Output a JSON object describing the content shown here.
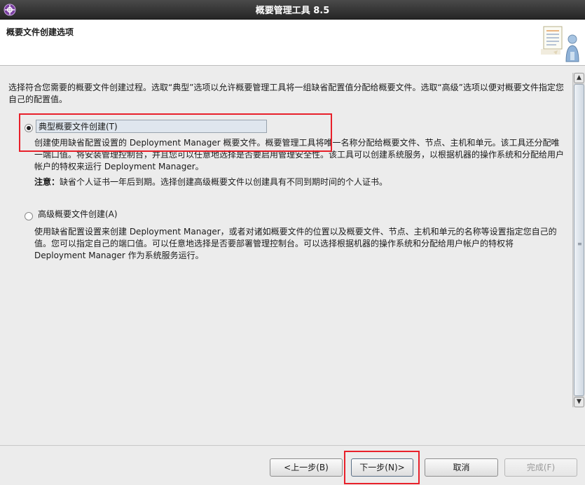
{
  "window": {
    "title": "概要管理工具 8.5",
    "app_icon": "gear-icon"
  },
  "header": {
    "title": "概要文件创建选项",
    "illustration": "checklist-person-icon"
  },
  "main": {
    "intro": "选择符合您需要的概要文件创建过程。选取“典型”选项以允许概要管理工具将一组缺省配置值分配给概要文件。选取“高级”选项以便对概要文件指定您自己的配置值。",
    "typical": {
      "label": "典型概要文件创建(T)",
      "selected": true,
      "description": "创建使用缺省配置设置的 Deployment Manager 概要文件。概要管理工具将唯一名称分配给概要文件、节点、主机和单元。该工具还分配唯一端口值。将安装管理控制台，并且您可以任意地选择是否要启用管理安全性。该工具可以创建系统服务，以根据机器的操作系统和分配给用户帐户的特权来运行 Deployment Manager。",
      "note_label": "注意：",
      "note_text": "缺省个人证书一年后到期。选择创建高级概要文件以创建具有不同到期时间的个人证书。"
    },
    "advanced": {
      "label": "高级概要文件创建(A)",
      "selected": false,
      "description": "使用缺省配置设置来创建 Deployment Manager，或者对诸如概要文件的位置以及概要文件、节点、主机和单元的名称等设置指定您自己的值。您可以指定自己的端口值。可以任意地选择是否要部署管理控制台。可以选择根据机器的操作系统和分配给用户帐户的特权将 Deployment Manager 作为系统服务运行。"
    }
  },
  "buttons": {
    "back": "<上一步(B)",
    "next": "下一步(N)>",
    "cancel": "取消",
    "finish": "完成(F)"
  },
  "colors": {
    "highlight": "#e8202a",
    "titlebar": "#262626"
  }
}
